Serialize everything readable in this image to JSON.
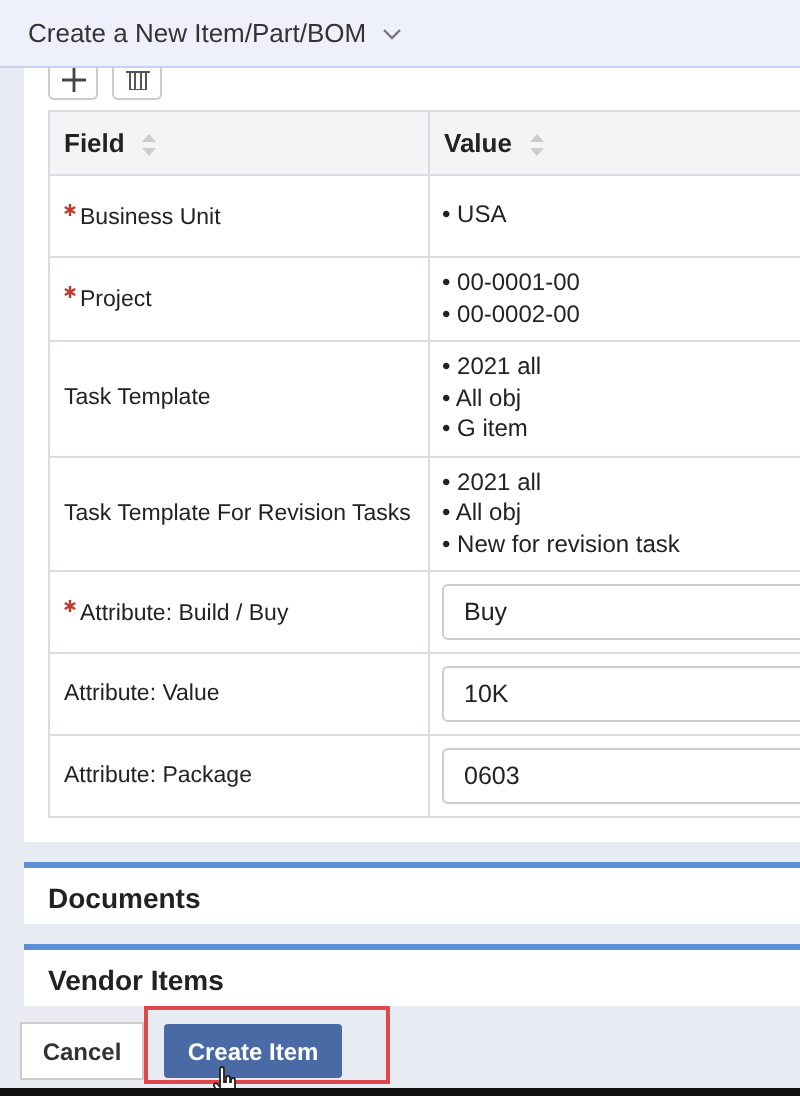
{
  "header": {
    "title": "Create a New Item/Part/BOM"
  },
  "table": {
    "columns": [
      "Field",
      "Value"
    ],
    "rows": [
      {
        "field": "Business Unit",
        "required": true,
        "kind": "list",
        "values": [
          "• USA"
        ]
      },
      {
        "field": "Project",
        "required": true,
        "kind": "list",
        "values": [
          "• 00-0001-00",
          "• 00-0002-00"
        ]
      },
      {
        "field": "Task Template",
        "required": false,
        "kind": "list",
        "values": [
          "• 2021 all",
          "• All obj",
          "• G item"
        ]
      },
      {
        "field": "Task Template For Revision Tasks",
        "required": false,
        "kind": "list",
        "values": [
          "• 2021 all",
          "• All obj",
          "• New for revision task"
        ]
      },
      {
        "field": "Attribute: Build / Buy",
        "required": true,
        "kind": "input",
        "value": "Buy"
      },
      {
        "field": "Attribute: Value",
        "required": false,
        "kind": "input",
        "value": "10K"
      },
      {
        "field": "Attribute: Package",
        "required": false,
        "kind": "input",
        "value": "0603"
      }
    ]
  },
  "sections": [
    "Documents",
    "Vendor Items"
  ],
  "buttons": {
    "cancel": "Cancel",
    "create": "Create Item"
  }
}
